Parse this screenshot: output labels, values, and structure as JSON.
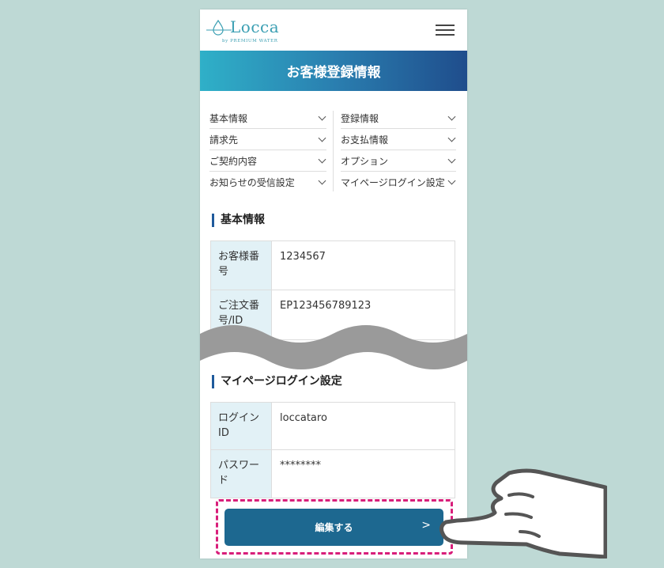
{
  "header": {
    "logo_text": "Locca",
    "logo_sub": "by PREMIUM WATER",
    "menu_icon": "hamburger-icon"
  },
  "banner": {
    "title": "お客様登録情報"
  },
  "nav": {
    "items": [
      {
        "label": "基本情報"
      },
      {
        "label": "登録情報"
      },
      {
        "label": "請求先"
      },
      {
        "label": "お支払情報"
      },
      {
        "label": "ご契約内容"
      },
      {
        "label": "オプション"
      },
      {
        "label": "お知らせの受信設定"
      },
      {
        "label": "マイページログイン設定"
      }
    ]
  },
  "basic_info": {
    "title": "基本情報",
    "rows": [
      {
        "label": "お客様番号",
        "value": "1234567"
      },
      {
        "label": "ご注文番号/ID",
        "value": "EP123456789123"
      }
    ]
  },
  "login_settings": {
    "title": "マイページログイン設定",
    "rows": [
      {
        "label": "ログインID",
        "value": "loccataro"
      },
      {
        "label": "パスワード",
        "value": "********"
      }
    ]
  },
  "actions": {
    "edit_label": "編集する",
    "edit_arrow": ">"
  },
  "colors": {
    "background": "#bed9d5",
    "banner_start": "#2fb0c8",
    "banner_end": "#1f4d8c",
    "button": "#1d6890",
    "highlight": "#d81e7a",
    "label_cell": "#e2f1f6"
  }
}
